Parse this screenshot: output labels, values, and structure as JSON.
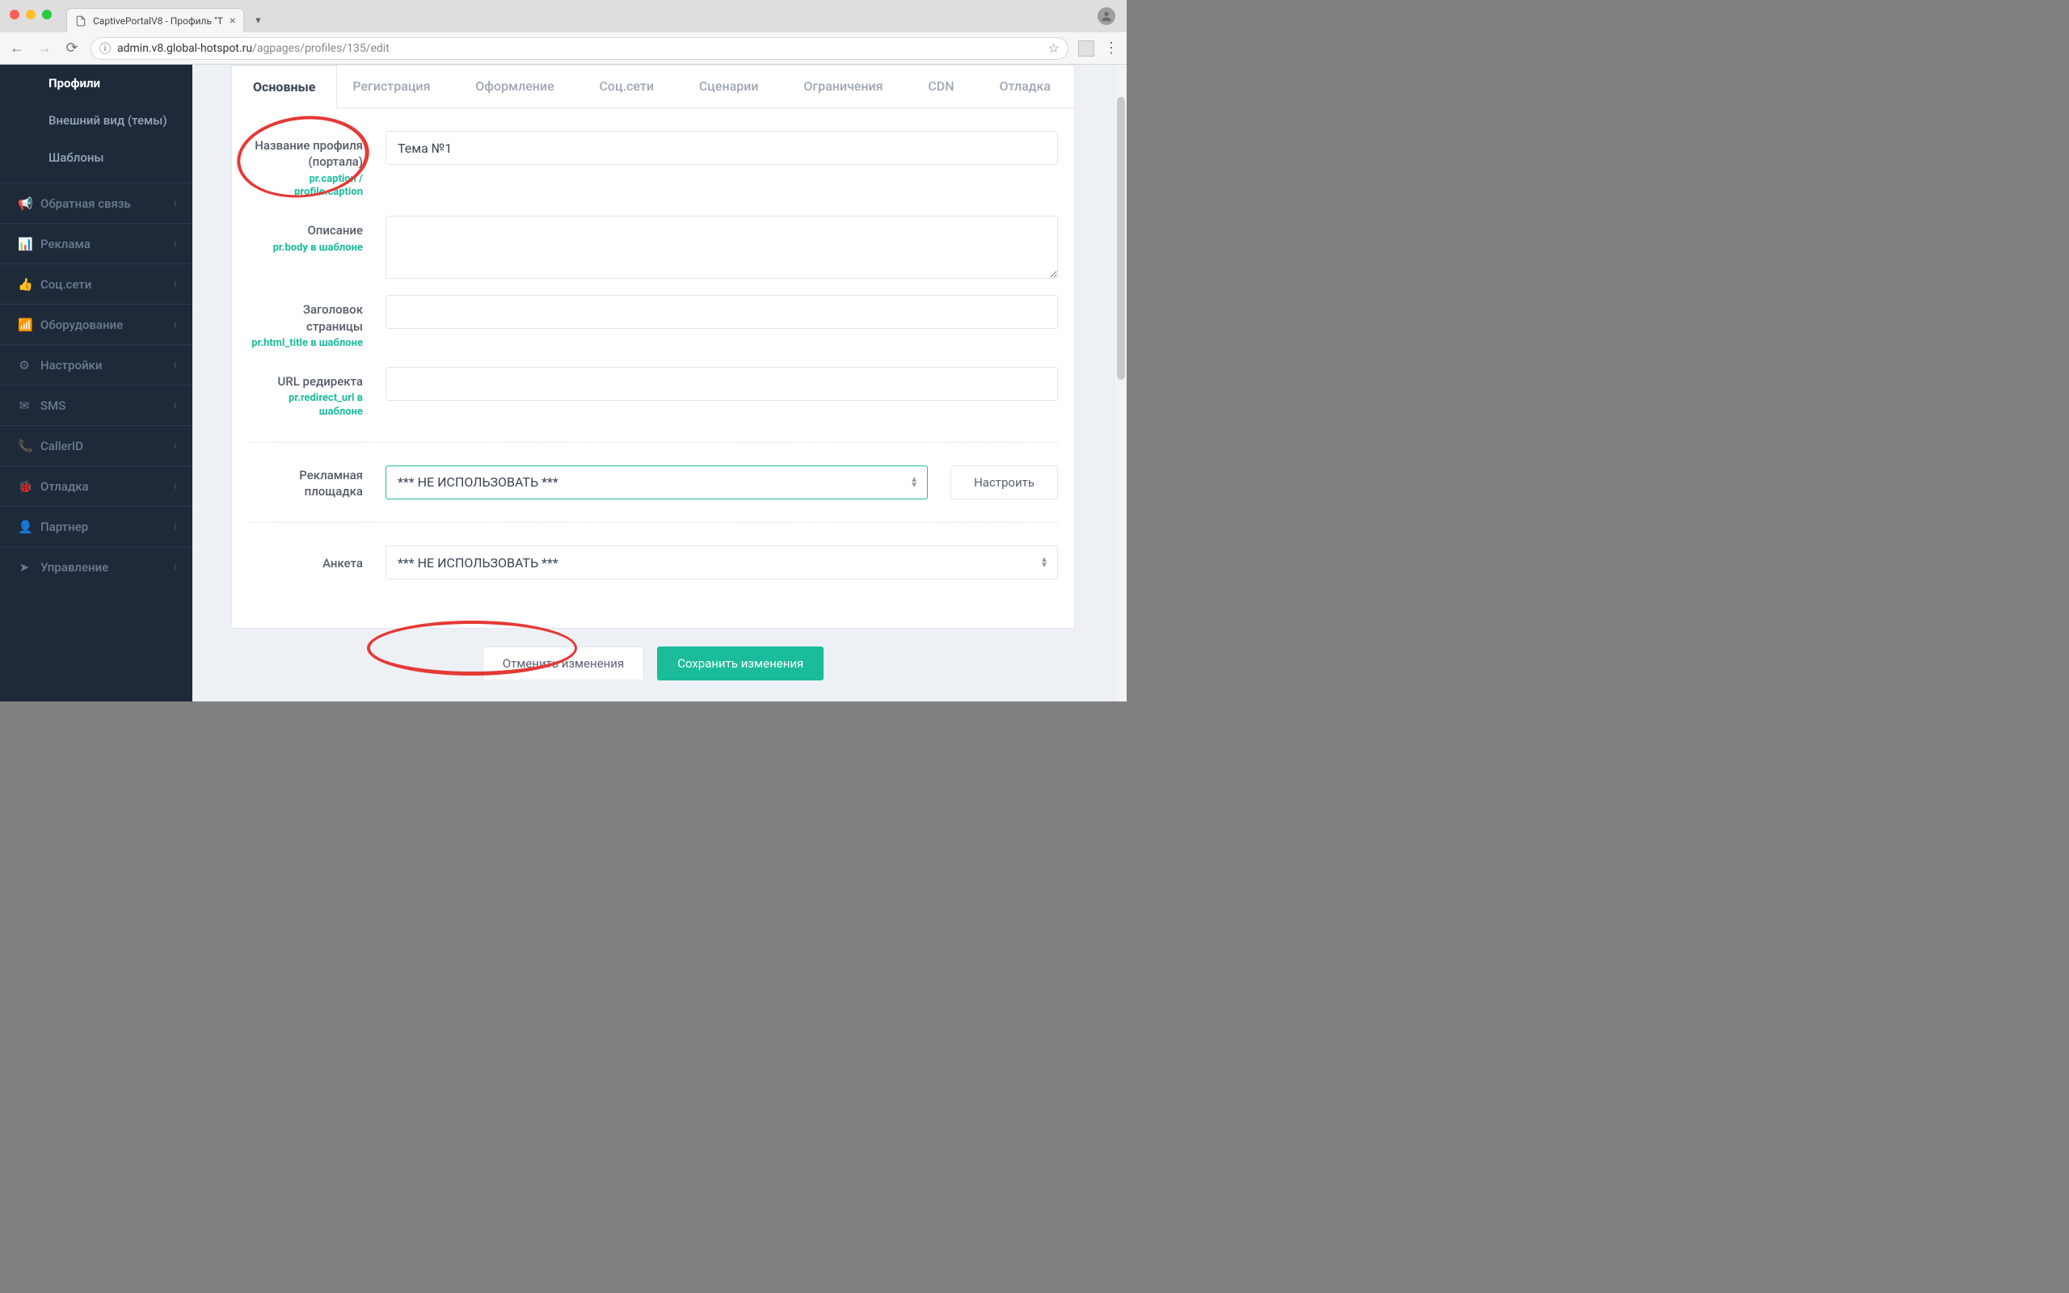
{
  "chrome": {
    "tab_title": "CaptivePortalV8 - Профиль \"Т",
    "url_host": "admin.v8.global-hotspot.ru",
    "url_path": "/agpages/profiles/135/edit"
  },
  "sidebar": {
    "subnav": [
      {
        "label": "Профили",
        "active": true
      },
      {
        "label": "Внешний вид (темы)",
        "active": false
      },
      {
        "label": "Шаблоны",
        "active": false
      }
    ],
    "nav": [
      {
        "icon": "📢",
        "label": "Обратная связь"
      },
      {
        "icon": "📊",
        "label": "Реклама"
      },
      {
        "icon": "👍",
        "label": "Соц.сети"
      },
      {
        "icon": "📶",
        "label": "Оборудование"
      },
      {
        "icon": "⚙",
        "label": "Настройки"
      },
      {
        "icon": "✉",
        "label": "SMS"
      },
      {
        "icon": "📞",
        "label": "CallerID"
      },
      {
        "icon": "🐞",
        "label": "Отладка"
      },
      {
        "icon": "👤",
        "label": "Партнер"
      },
      {
        "icon": "➤",
        "label": "Управление"
      }
    ]
  },
  "tabs": {
    "items": [
      "Основные",
      "Регистрация",
      "Оформление",
      "Соц.сети",
      "Сценарии",
      "Ограничения",
      "CDN",
      "Отладка"
    ],
    "active_index": 0
  },
  "form": {
    "profile_name": {
      "label": "Название профиля (портала)",
      "hint": "pr.caption / profile.caption",
      "value": "Тема №1"
    },
    "description": {
      "label": "Описание",
      "hint": "pr.body в шаблоне",
      "value": ""
    },
    "page_title": {
      "label": "Заголовок страницы",
      "hint": "pr.html_title в шаблоне",
      "value": ""
    },
    "redirect_url": {
      "label": "URL редиректа",
      "hint": "pr.redirect_url в шаблоне",
      "value": ""
    },
    "ad_placement": {
      "label": "Рекламная площадка",
      "selected": "*** НЕ ИСПОЛЬЗОВАТЬ ***",
      "configure_btn": "Настроить"
    },
    "survey": {
      "label": "Анкета",
      "selected": "*** НЕ ИСПОЛЬЗОВАТЬ ***"
    }
  },
  "actions": {
    "cancel": "Отменить изменения",
    "save": "Сохранить изменения"
  }
}
